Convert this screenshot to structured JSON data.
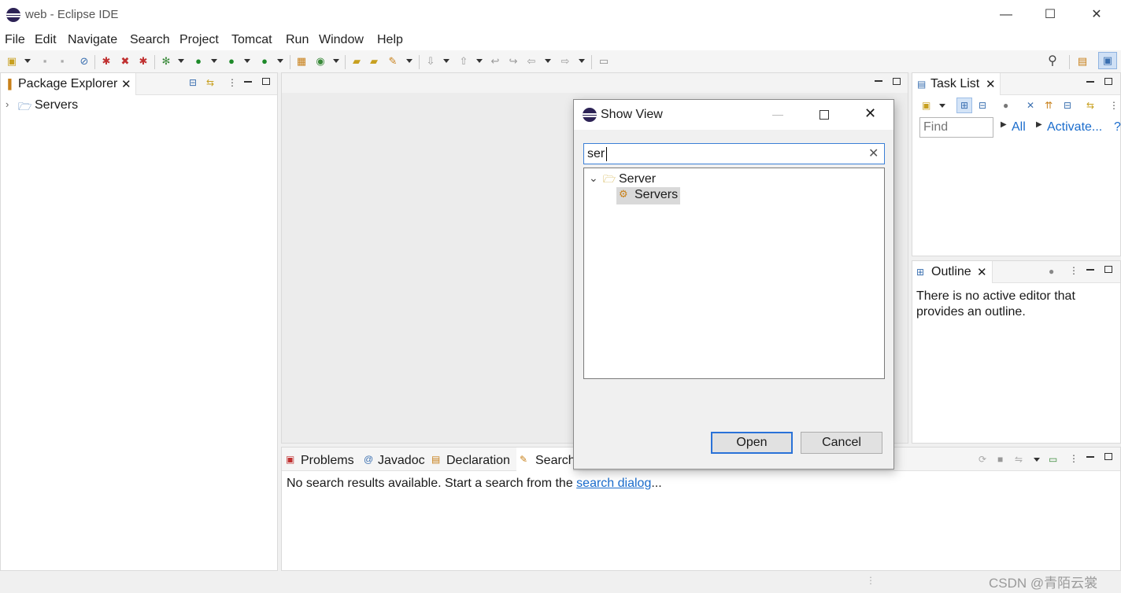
{
  "window": {
    "title": "web - Eclipse IDE",
    "minimize": "—",
    "maximize": "☐",
    "close": "✕"
  },
  "menu": [
    "File",
    "Edit",
    "Navigate",
    "Search",
    "Project",
    "Tomcat",
    "Run",
    "Window",
    "Help"
  ],
  "package_explorer": {
    "tab": "Package Explorer",
    "tree": [
      {
        "label": "Servers",
        "expanded": false
      }
    ]
  },
  "task_list": {
    "tab": "Task List",
    "find_placeholder": "Find",
    "all_label": "All",
    "activate_label": "Activate...",
    "help": "?"
  },
  "outline": {
    "tab": "Outline",
    "message": "There is no active editor that provides an outline."
  },
  "bottom_tabs": [
    "Problems",
    "Javadoc",
    "Declaration",
    "Search"
  ],
  "search_view": {
    "message_prefix": "No search results available. Start a search from the ",
    "link": "search dialog",
    "suffix": "..."
  },
  "dialog": {
    "title": "Show View",
    "filter_value": "ser",
    "tree": {
      "category": "Server",
      "item": "Servers"
    },
    "open_label": "Open",
    "cancel_label": "Cancel"
  },
  "watermark": "CSDN @青陌云裳"
}
